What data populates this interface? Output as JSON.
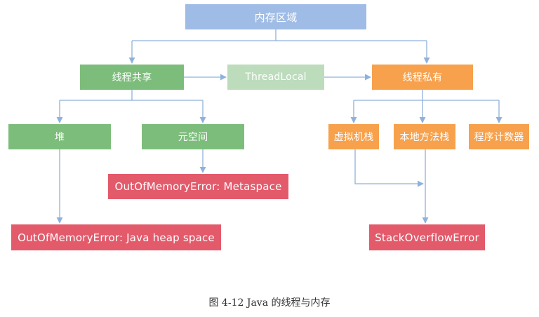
{
  "nodes": {
    "root": "内存区域",
    "thread_shared": "线程共享",
    "thread_local": "ThreadLocal",
    "thread_private": "线程私有",
    "heap": "堆",
    "metaspace": "元空间",
    "vm_stack": "虚拟机栈",
    "native_method_stack": "本地方法栈",
    "program_counter": "程序计数器",
    "oom_metaspace": "OutOfMemoryError: Metaspace",
    "oom_heap": "OutOfMemoryError: Java heap space",
    "stack_overflow": "StackOverflowError"
  },
  "caption": "图 4-12   Java 的线程与内存",
  "colors": {
    "root": "#9fbce6",
    "shared_group": "#7dbd7b",
    "thread_local": "#bcdcbc",
    "private_group": "#f7a14c",
    "errors": "#e35a6b",
    "connector": "#8fb1dc"
  }
}
